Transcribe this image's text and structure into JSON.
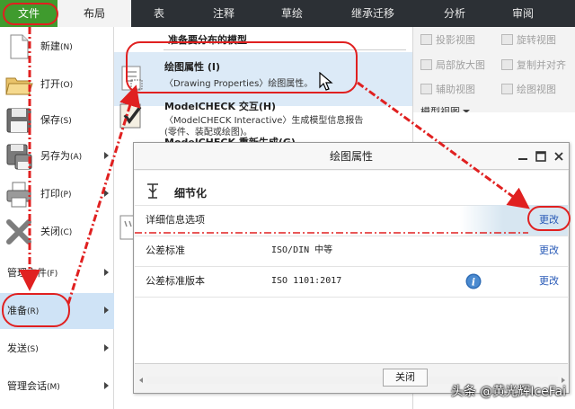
{
  "tabs": [
    "文件",
    "布局",
    "表",
    "注释",
    "草绘",
    "继承迁移",
    "分析",
    "审阅"
  ],
  "left_menu": [
    {
      "label": "新建",
      "shortcut": "(N)",
      "icon": "new-file-icon",
      "arrow": false
    },
    {
      "label": "打开",
      "shortcut": "(O)",
      "icon": "open-folder-icon",
      "arrow": false
    },
    {
      "label": "保存",
      "shortcut": "(S)",
      "icon": "save-disk-icon",
      "arrow": false
    },
    {
      "label": "另存为",
      "shortcut": "(A)",
      "icon": "save-as-icon",
      "arrow": true
    },
    {
      "label": "打印",
      "shortcut": "(P)",
      "icon": "printer-icon",
      "arrow": true
    },
    {
      "label": "关闭",
      "shortcut": "(C)",
      "icon": "close-x-icon",
      "arrow": false
    },
    {
      "label": "管理文件",
      "shortcut": "(F)",
      "arrow": true
    },
    {
      "label": "准备",
      "shortcut": "(R)",
      "arrow": true,
      "selected": true
    },
    {
      "label": "发送",
      "shortcut": "(S)",
      "arrow": true
    },
    {
      "label": "管理会话",
      "shortcut": "(M)",
      "arrow": true
    }
  ],
  "submenu": {
    "header": "准备要分布的模型",
    "items": [
      {
        "title": "绘图属性 (I)",
        "desc": "〈Drawing Properties〉绘图属性。",
        "icon": "drawing-properties-icon"
      },
      {
        "title": "ModelCHECK 交互(H)",
        "desc": "〈ModelCHECK Interactive〉生成模型信息报告",
        "desc2": "(零件、装配或绘图)。",
        "icon": "modelcheck-icon"
      },
      {
        "title": "ModelCHECK 重新生成(G)",
        "icon": "regenerate-icon"
      }
    ]
  },
  "ribbon": {
    "buttons": [
      "投影视图",
      "旋转视图",
      "局部放大图",
      "复制并对齐",
      "辅助视图",
      "绘图视图"
    ],
    "group": "模型视图"
  },
  "dialog": {
    "title": "绘图属性",
    "section": "细节化",
    "rows": [
      {
        "label": "详细信息选项",
        "value": "",
        "action": "更改"
      },
      {
        "label": "公差标准",
        "value": "ISO/DIN 中等",
        "action": "更改"
      },
      {
        "label": "公差标准版本",
        "value": "ISO 1101:2017",
        "action": "更改",
        "info_icon": "info-icon"
      }
    ],
    "close_label": "关闭"
  },
  "watermark": "头条 @黄光辉IceFai",
  "colors": {
    "file_tab": "#3f9b2e",
    "topbar": "#2c3035",
    "selected": "#cfe3f6",
    "link": "#2a5bb7",
    "annotation": "#e02020"
  }
}
